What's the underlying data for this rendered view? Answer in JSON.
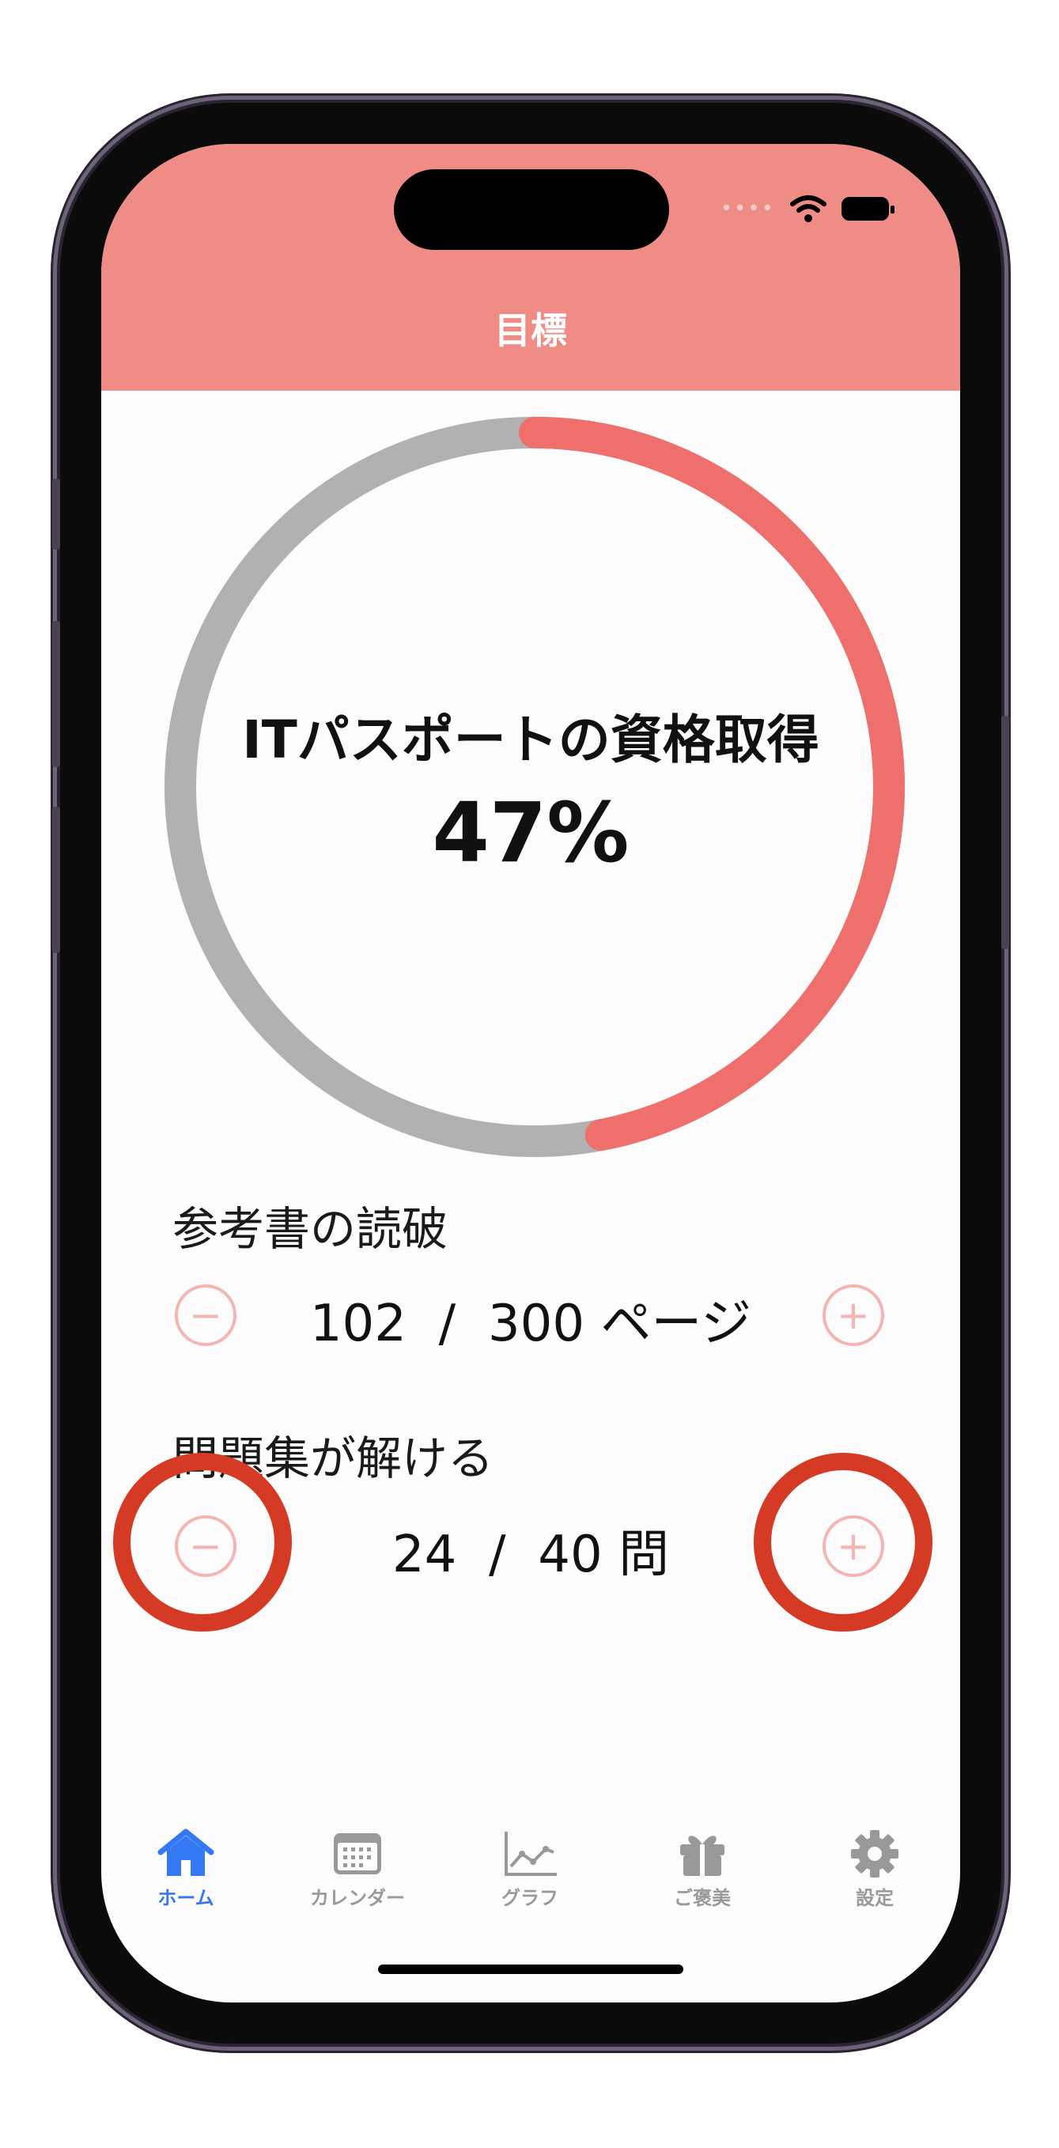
{
  "header": {
    "title": "目標"
  },
  "goal": {
    "name": "ITパスポートの資格取得",
    "percent_label": "47%",
    "progress": 0.47
  },
  "tasks": [
    {
      "label": "参考書の読破",
      "current": "102",
      "total": "300",
      "unit": "ページ",
      "separator": "/"
    },
    {
      "label": "問題集が解ける",
      "current": "24",
      "total": "40",
      "unit": "問",
      "separator": "/"
    }
  ],
  "buttons": {
    "minus": "−",
    "plus": "+"
  },
  "tabs": [
    {
      "label": "ホーム",
      "icon": "house-icon",
      "active": true
    },
    {
      "label": "カレンダー",
      "icon": "calendar-icon",
      "active": false
    },
    {
      "label": "グラフ",
      "icon": "chart-icon",
      "active": false
    },
    {
      "label": "ご褒美",
      "icon": "gift-icon",
      "active": false
    },
    {
      "label": "設定",
      "icon": "gear-icon",
      "active": false
    }
  ],
  "colors": {
    "header": "#ef8c86",
    "progress": "#ee6f6b",
    "track": "#b1b1b1",
    "button": "#f3b5b2",
    "highlight": "#d53b24",
    "tab_active": "#3478f6",
    "tab_inactive": "#999999"
  }
}
